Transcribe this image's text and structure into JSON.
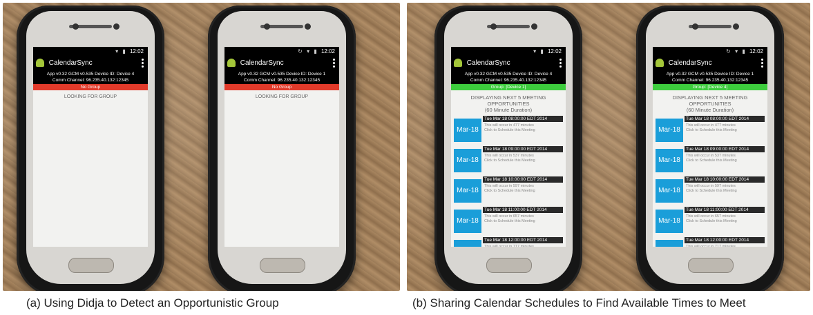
{
  "captions": {
    "a": "(a) Using Didja to Detect an Opportunistic Group",
    "b": "(b) Sharing Calendar Schedules to Find Available Times to Meet"
  },
  "app": {
    "name": "CalendarSync",
    "time": "12:02"
  },
  "phones": {
    "a1": {
      "info1": "App v0.32  GCM v0.535  Device ID: Device 4",
      "info2": "Comm Channel: 96.235.40.132:12345",
      "group": "No Group",
      "status": "LOOKING FOR GROUP"
    },
    "a2": {
      "info1": "App v0.32  GCM v0.535  Device ID: Device 1",
      "info2": "Comm Channel: 96.235.40.132:12345",
      "group": "No Group",
      "status": "LOOKING FOR GROUP"
    },
    "b1": {
      "info1": "App v0.32  GCM v0.535  Device ID: Device 4",
      "info2": "Comm Channel: 96.235.40.132:12345",
      "group": "Group: [Device 1]"
    },
    "b2": {
      "info1": "App v0.32  GCM v0.535  Device ID: Device 1",
      "info2": "Comm Channel: 96.235.40.132:12345",
      "group": "Group: [Device 4]"
    }
  },
  "schedule": {
    "heading": "DISPLAYING NEXT 5 MEETING OPPORTUNITIES",
    "duration": "(60 Minute Duration)",
    "schedule_label": "Click to Schedule this Meeting",
    "meetings": [
      {
        "date": "Mar-18",
        "title": "Tue Mar 18 08:00:00 EDT 2014",
        "occur": "This will occur in 477 minutes"
      },
      {
        "date": "Mar-18",
        "title": "Tue Mar 18 09:00:00 EDT 2014",
        "occur": "This will occur in 537 minutes"
      },
      {
        "date": "Mar-18",
        "title": "Tue Mar 18 10:00:00 EDT 2014",
        "occur": "This will occur in 597 minutes"
      },
      {
        "date": "Mar-18",
        "title": "Tue Mar 18 11:00:00 EDT 2014",
        "occur": "This will occur in 657 minutes"
      },
      {
        "date": "Mar-18",
        "title": "Tue Mar 18 12:00:00 EDT 2014",
        "occur": "This will occur in 717 minutes"
      }
    ]
  },
  "colors": {
    "no_group": "#e23a2a",
    "group": "#3dcc3d",
    "date_tile": "#1a9ed9"
  }
}
